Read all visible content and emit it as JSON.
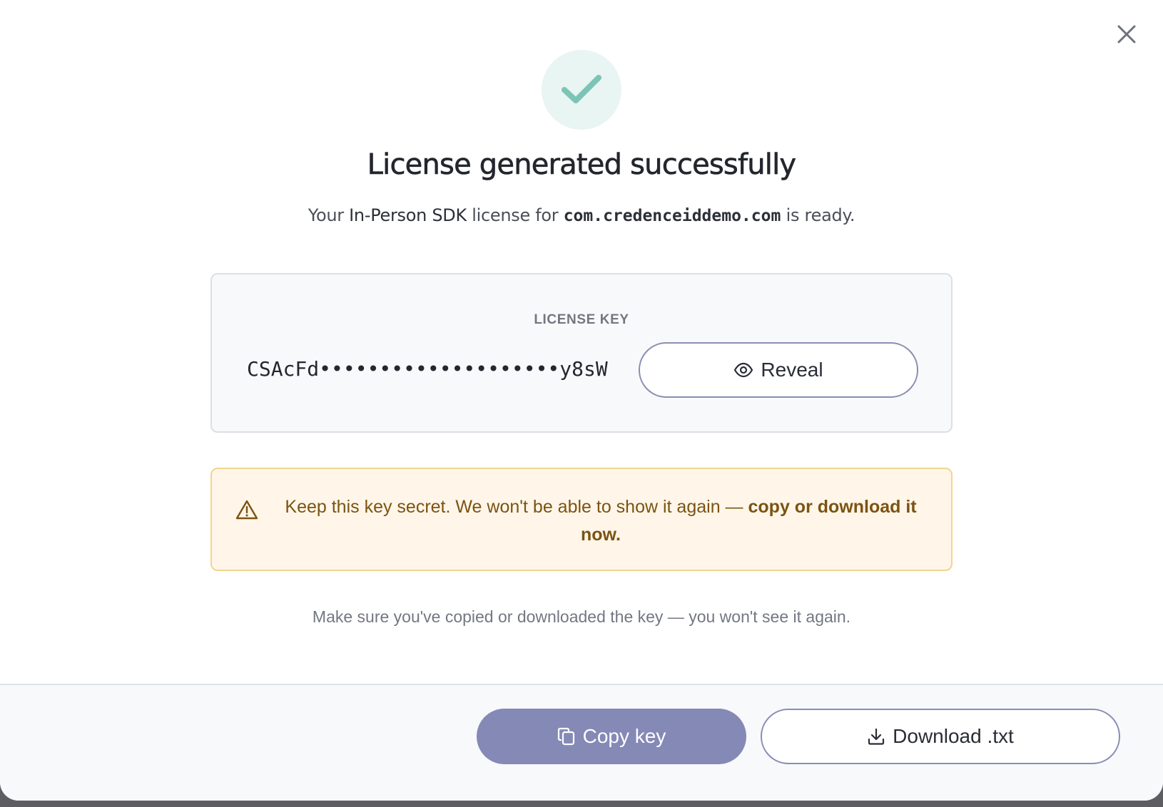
{
  "dialog": {
    "title": "License generated successfully",
    "subtitle": {
      "prefix": "Your ",
      "product": "In-Person SDK",
      "middle": " license for ",
      "app_id": "com.credenceiddemo.com",
      "suffix": " is ready."
    },
    "close_icon": "close-icon",
    "success_icon": "checkmark-icon"
  },
  "license_card": {
    "label": "LICENSE KEY",
    "masked_key": "CSAcFd••••••••••••••••••••y8sW",
    "reveal_label": "Reveal",
    "reveal_icon": "eye-icon"
  },
  "warning": {
    "text": "Keep this key secret. We won't be able to show it again — ",
    "emphasis": "copy or download it now.",
    "icon": "warning-triangle-icon"
  },
  "hint": "Make sure you've copied or downloaded the key — you won't see it again.",
  "footer": {
    "copy_label": "Copy key",
    "copy_icon": "copy-icon",
    "download_label": "Download .txt",
    "download_icon": "download-icon"
  },
  "colors": {
    "accent": "#8589b6",
    "success": "#7cc4b4",
    "success_bg": "#e8f5f2",
    "warning_bg": "#fff6e9",
    "warning_border": "#f1d58e",
    "warning_text": "#7b5312"
  }
}
